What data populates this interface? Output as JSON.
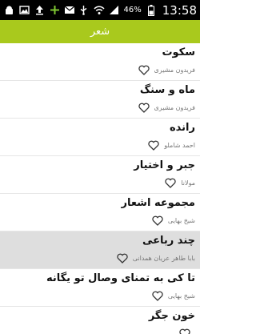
{
  "status_bar": {
    "battery_percent": "46%",
    "time": "13:58",
    "icons": [
      "android-icon",
      "image-icon",
      "upload-icon",
      "add-icon",
      "mail-icon",
      "usb-icon",
      "wifi-icon",
      "signal-icon",
      "battery-icon"
    ]
  },
  "app_bar": {
    "title": "شعر"
  },
  "poems": [
    {
      "title": "سکوت",
      "author": "فریدون مشیری"
    },
    {
      "title": "ماه و سنگ",
      "author": "فریدون مشیری"
    },
    {
      "title": "رانده",
      "author": "احمد شاملو"
    },
    {
      "title": "جبر و اختیار",
      "author": "مولانا"
    },
    {
      "title": "مجموعه اشعار",
      "author": "شیخ بهایی"
    },
    {
      "title": "چند رباعی",
      "author": "بابا طاهر عریان همدانی"
    },
    {
      "title": "تا کی به تمنای وصال تو یگانه",
      "author": "شیخ بهایی"
    },
    {
      "title": "خون جگر",
      "author": ""
    }
  ],
  "colors": {
    "accent": "#a9c91d",
    "selected_row": "#dedede",
    "status_bar": "#000000"
  }
}
